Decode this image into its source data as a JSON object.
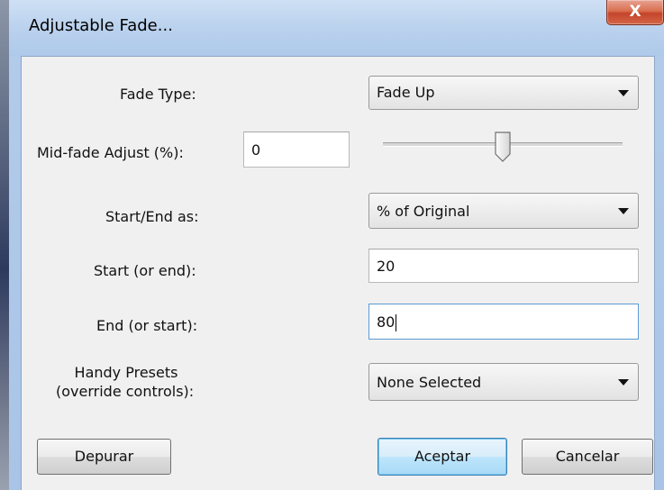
{
  "window": {
    "title": "Adjustable Fade...",
    "close_glyph": "X"
  },
  "form": {
    "fade_type": {
      "label": "Fade Type:",
      "value": "Fade Up"
    },
    "mid_fade": {
      "label": "Mid-fade Adjust (%):",
      "value": "0",
      "slider_fraction": 0.5
    },
    "start_end_as": {
      "label": "Start/End as:",
      "value": "% of Original"
    },
    "start": {
      "label": "Start (or end):",
      "value": "20"
    },
    "end": {
      "label": "End (or start):",
      "value": "80"
    },
    "presets": {
      "label_line1": "Handy Presets",
      "label_line2": "(override controls):",
      "value": "None Selected"
    }
  },
  "buttons": {
    "debug": "Depurar",
    "ok": "Aceptar",
    "cancel": "Cancelar"
  }
}
